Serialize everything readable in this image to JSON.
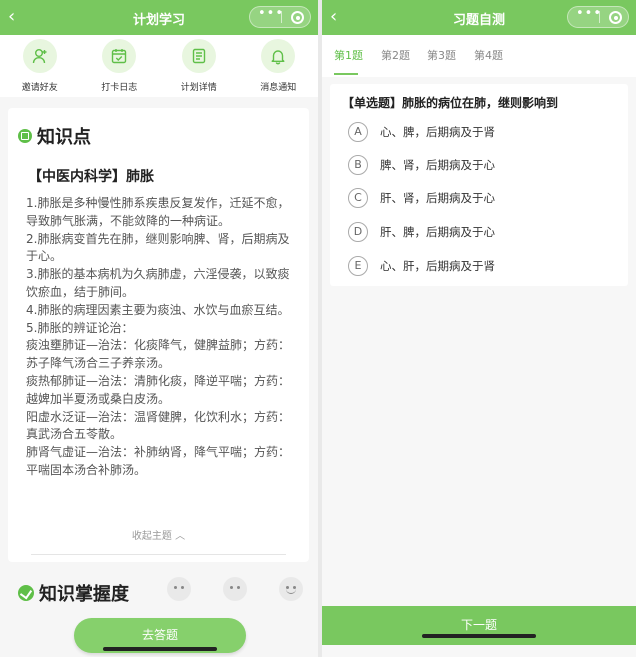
{
  "left": {
    "nav": {
      "back_glyph": "‹",
      "title": "计划学习",
      "capsule_dots": "•••"
    },
    "quick_actions": [
      {
        "label": "邀请好友",
        "icon": "user-plus-icon"
      },
      {
        "label": "打卡日志",
        "icon": "calendar-check-icon"
      },
      {
        "label": "计划详情",
        "icon": "document-icon"
      },
      {
        "label": "消息通知",
        "icon": "bell-icon"
      }
    ],
    "knowledge": {
      "section_title": "知识点",
      "subtitle": "【中医内科学】肺胀",
      "lines": [
        "1.肺胀是多种慢性肺系疾患反复发作，迁延不愈，导致肺气胀满，不能敛降的一种病证。",
        "2.肺胀病变首先在肺，继则影响脾、肾，后期病及于心。",
        "3.肺胀的基本病机为久病肺虚，六淫侵袭，以致痰饮瘀血，结于肺间。",
        "4.肺胀的病理因素主要为痰浊、水饮与血瘀互结。",
        "5.肺胀的辨证论治：",
        "痰浊壅肺证—治法：化痰降气，健脾益肺；方药：苏子降气汤合三子养亲汤。",
        "痰热郁肺证—治法：清肺化痰，降逆平喘；方药：越婢加半夏汤或桑白皮汤。",
        "阳虚水泛证—治法：温肾健脾，化饮利水；方药：真武汤合五苓散。",
        "肺肾气虚证—治法：补肺纳肾，降气平喘；方药：平喘固本汤合补肺汤。"
      ],
      "collapse_label": "收起主题 ︿"
    },
    "mastery_title": "知识掌握度",
    "go_answer_label": "去答题"
  },
  "right": {
    "nav": {
      "back_glyph": "‹",
      "title": "习题自测",
      "capsule_dots": "•••"
    },
    "tabs": [
      "第1题",
      "第2题",
      "第3题",
      "第4题"
    ],
    "active_tab": 0,
    "question": {
      "text": "【单选题】肺胀的病位在肺，继则影响到",
      "options": [
        {
          "letter": "A",
          "text": "心、脾，后期病及于肾"
        },
        {
          "letter": "B",
          "text": "脾、肾，后期病及于心"
        },
        {
          "letter": "C",
          "text": "肝、肾，后期病及于心"
        },
        {
          "letter": "D",
          "text": "肝、脾，后期病及于心"
        },
        {
          "letter": "E",
          "text": "心、肝，后期病及于肾"
        }
      ]
    },
    "next_label": "下一题"
  },
  "colors": {
    "accent": "#79c85f",
    "accent_dark": "#5fbf48",
    "button": "#86d06c"
  }
}
